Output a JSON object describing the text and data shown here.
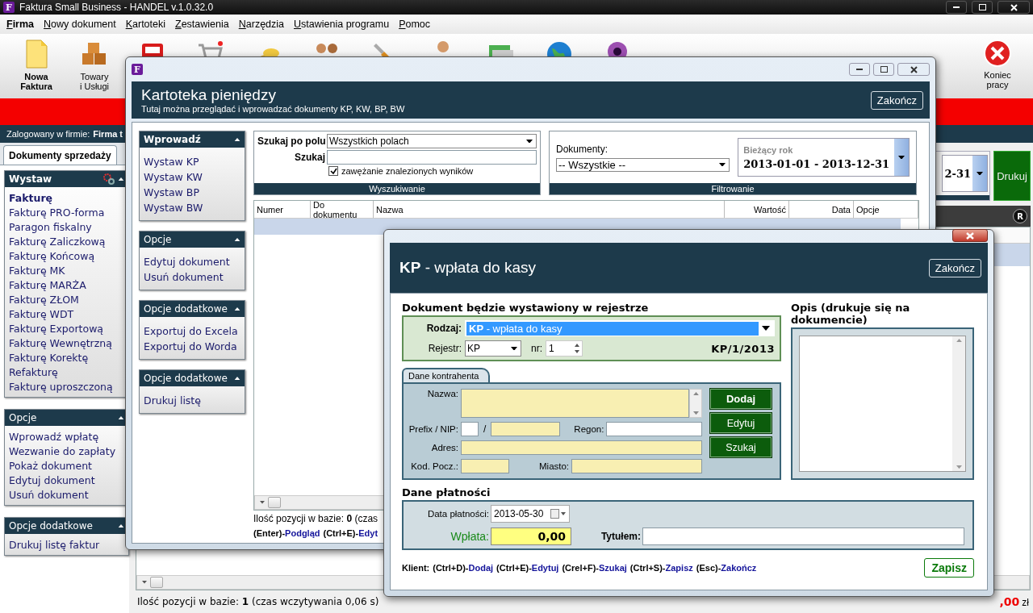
{
  "window": {
    "title": "Faktura Small Business - HANDEL v.1.0.32.0",
    "logo_letter": "F"
  },
  "menu": [
    {
      "label": "Firma",
      "selected": true
    },
    {
      "label": "Nowy dokument",
      "selected": false
    },
    {
      "label": "Kartoteki",
      "selected": false
    },
    {
      "label": "Zestawienia",
      "selected": false
    },
    {
      "label": "Narzędzia",
      "selected": false
    },
    {
      "label": "Ustawienia programu",
      "selected": false
    },
    {
      "label": "Pomoc",
      "selected": false
    }
  ],
  "toolbar": [
    {
      "kind": "document",
      "label": [
        "Nowa",
        "Faktura"
      ],
      "bold": true
    },
    {
      "kind": "boxes",
      "label": [
        "Towary",
        "i Usługi"
      ],
      "bold": false
    },
    {
      "kind": "register"
    },
    {
      "kind": "cart"
    },
    {
      "kind": "coins"
    },
    {
      "kind": "people"
    },
    {
      "kind": "tools"
    },
    {
      "kind": "user"
    },
    {
      "kind": "cards"
    },
    {
      "kind": "globe"
    },
    {
      "kind": "webcam"
    }
  ],
  "exit_button": {
    "label": [
      "Koniec",
      "pracy"
    ]
  },
  "login": {
    "label": "Zalogowany w firmie:",
    "company": "Firma t"
  },
  "tabs": [
    {
      "label": "Dokumenty sprzedaży",
      "selected": true
    }
  ],
  "sidebar": [
    {
      "title": "Wystaw",
      "title_bold": true,
      "settings": true,
      "items": [
        {
          "label": "Fakturę",
          "bold": true
        },
        {
          "label": "Fakturę PRO-forma",
          "bold": false
        },
        {
          "label": "Paragon fiskalny",
          "bold": false
        },
        {
          "label": "Fakturę Zaliczkową",
          "bold": false
        },
        {
          "label": "Fakturę Końcową",
          "bold": false
        },
        {
          "label": "Fakturę MK",
          "bold": false
        },
        {
          "label": "Fakturę MARŻA",
          "bold": false
        },
        {
          "label": "Fakturę ZŁOM",
          "bold": false
        },
        {
          "label": "Fakturę WDT",
          "bold": false
        },
        {
          "label": "Fakturę Exportową",
          "bold": false
        },
        {
          "label": "Fakturę Wewnętrzną",
          "bold": false
        },
        {
          "label": "Fakturę Korektę",
          "bold": false
        },
        {
          "label": "Refakturę",
          "bold": false
        },
        {
          "label": "Fakturę uproszczoną",
          "bold": false
        }
      ]
    },
    {
      "title": "Opcje",
      "title_bold": false,
      "settings": false,
      "items": [
        {
          "label": "Wprowadź wpłatę",
          "bold": false
        },
        {
          "label": "Wezwanie do zapłaty",
          "bold": false
        },
        {
          "label": "Pokaż dokument",
          "bold": false
        },
        {
          "label": "Edytuj dokument",
          "bold": false
        },
        {
          "label": "Usuń dokument",
          "bold": false
        }
      ]
    },
    {
      "title": "Opcje dodatkowe",
      "title_bold": false,
      "settings": false,
      "items": [
        {
          "label": "Drukuj listę faktur",
          "bold": false
        }
      ]
    }
  ],
  "main": {
    "date_fragment": "2-31",
    "print_button": "Drukuj",
    "badge": "R",
    "rows": [
      {
        "selected": true
      }
    ],
    "status": "Ilość pozycji w bazie: **1** (czas wczytywania 0,06 s)",
    "total": ",00",
    "currency": "zł"
  },
  "kartoteka": {
    "logo_letter": "F",
    "title": "Kartoteka pieniędzy",
    "subtitle": "Tutaj można przeglądać i wprowadzać dokumenty KP, KW, BP, BW",
    "close": "Zakończ",
    "panels": [
      {
        "title": "Wprowadź",
        "title_bold": true,
        "settings": false,
        "items": [
          {
            "label": "Wystaw KP",
            "bold": false
          },
          {
            "label": "Wystaw KW",
            "bold": false
          },
          {
            "label": "Wystaw BP",
            "bold": false
          },
          {
            "label": "Wystaw BW",
            "bold": false
          }
        ]
      },
      {
        "title": "Opcje",
        "title_bold": false,
        "settings": false,
        "items": [
          {
            "label": "Edytuj dokument",
            "bold": false
          },
          {
            "label": "Usuń dokument",
            "bold": false
          }
        ]
      },
      {
        "title": "Opcje dodatkowe",
        "title_bold": false,
        "settings": false,
        "items": [
          {
            "label": "Exportuj do Excela",
            "bold": false
          },
          {
            "label": "Exportuj do Worda",
            "bold": false
          }
        ]
      },
      {
        "title": "Opcje dodatkowe",
        "title_bold": false,
        "settings": false,
        "items": [
          {
            "label": "Drukuj listę",
            "bold": false
          }
        ]
      }
    ],
    "search": {
      "field_label": "Szukaj po polu",
      "field_value": "Wszystkich polach",
      "query_label": "Szukaj",
      "narrow": {
        "label": "zawężanie znalezionych wyników",
        "checked": true
      },
      "caption": "Wyszukiwanie"
    },
    "filter": {
      "documents_label": "Dokumenty:",
      "documents_value": "-- Wszystkie --",
      "period_label": "Bieżący rok",
      "period_value": "2013-01-01 - 2013-12-31",
      "caption": "Filtrowanie"
    },
    "table": {
      "columns": [
        "Numer",
        "Do dokumentu",
        "Nazwa",
        "Wartość",
        "Data",
        "Opcje"
      ],
      "rows": [
        {
          "selected": true
        }
      ]
    },
    "status": "Ilość pozycji w bazie: **0** (czas",
    "shortcuts": [
      {
        "key": "(Enter)-",
        "action": "Podgląd"
      },
      {
        "key": "(Ctrl+E)-",
        "action": "Edyt"
      }
    ]
  },
  "kp_dialog": {
    "title_code": "KP",
    "title": "- wpłata do kasy",
    "close": "Zakończ",
    "register_section": {
      "heading": "Dokument będzie wystawiony w rejestrze",
      "kind_label": "Rodzaj:",
      "kind_value": "**KP** - wpłata do kasy",
      "register_label": "Rejestr:",
      "register_value": "KP",
      "nr_label": "nr:",
      "nr_value": "1",
      "number": "KP/1/2013"
    },
    "contractor": {
      "tab": "Dane kontrahenta",
      "name": {
        "label": "Nazwa:",
        "required": true
      },
      "prefix": {
        "label": "Prefix / NIP:",
        "required": false
      },
      "separator": "/",
      "nip": {
        "required": true
      },
      "regon": {
        "label": "Regon:",
        "required": false
      },
      "address": {
        "label": "Adres:",
        "required": true
      },
      "zip": {
        "label": "Kod. Pocz.:",
        "required": true
      },
      "city": {
        "label": "Miasto:",
        "required": true
      },
      "buttons": [
        {
          "label": "Dodaj",
          "bold": true
        },
        {
          "label": "Edytuj",
          "bold": false
        },
        {
          "label": "Szukaj",
          "bold": false
        }
      ]
    },
    "description": {
      "heading": "Opis (drukuje się na dokumencie)"
    },
    "payment": {
      "heading": "Dane płatności",
      "date_label": "Data płatności:",
      "date_value": "2013-05-30",
      "amount_label": "Wpłata:",
      "amount_value": "0,00",
      "title_label": "Tytułem:"
    },
    "shortcuts": {
      "label": "Klient:",
      "items": [
        {
          "key": "(Ctrl+D)-",
          "action": "Dodaj"
        },
        {
          "key": "(Ctrl+E)-",
          "action": "Edytuj"
        },
        {
          "key": "(Crel+F)-",
          "action": "Szukaj"
        },
        {
          "key": "(Ctrl+S)-",
          "action": "Zapisz"
        },
        {
          "key": "(Esc)-",
          "action": "Zakończ"
        }
      ]
    },
    "save": "Zapisz"
  }
}
